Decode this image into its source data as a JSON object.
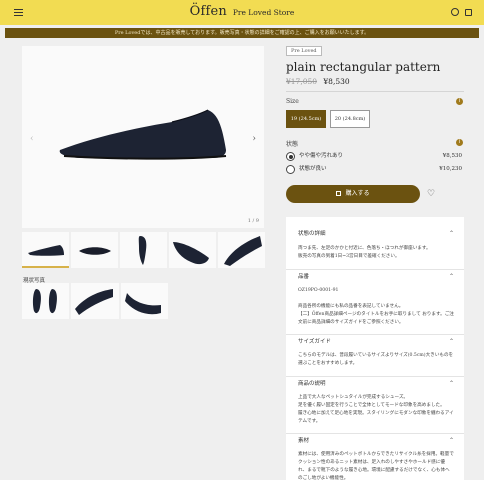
{
  "header": {
    "logo": "Öffen",
    "store_name": "Pre Loved Store"
  },
  "notice": "Pre Lovedでは、中古品を販売しております。販売写真・状態の詳細をご確認の上、ご購入をお願いいたします。",
  "gallery": {
    "counter": "1 / 9",
    "actual_title": "現状写真"
  },
  "product": {
    "badge": "Pre Loved",
    "title": "plain rectangular pattern",
    "original_price": "¥17,050",
    "price": "¥8,530"
  },
  "size": {
    "label": "Size",
    "options": [
      "19 (24.5cm)",
      "20 (24.8cm)"
    ],
    "selected_index": 0
  },
  "condition": {
    "label": "状態",
    "options": [
      {
        "name": "やや傷や汚れあり",
        "price": "¥8,530",
        "selected": true
      },
      {
        "name": "状態が良い",
        "price": "¥10,230",
        "selected": false
      }
    ]
  },
  "buy_button": "購入する",
  "accordion": [
    {
      "title": "状態の詳細",
      "body": "両つま先、左足のかかと付近に、色落ち・ほつれが御座います。\n販売の写真の到着1日~3営日目で差確ください。"
    },
    {
      "title": "品番",
      "body": "OZ19PO-0001-91\n\n商品各所の機能にも私の品番を表記していません。\n【二】Öffen商品詳細ページのタイトルをお手に取りまして おります。ご注文前に商品詳細のサイズガイドをご参照ください。"
    },
    {
      "title": "サイズガイド",
      "body": "こちらのモデルは、普段履いているサイズよりサイズ(0.5cm)大きいものを選ぶことをおすすめします。"
    },
    {
      "title": "商品の説明",
      "body": "上品で大人なペットシュタイルが完成するシューズ。\n足を優く履い固定を行うことで全体としてモードな印象を高めました。\n履き心地に加えて足心地を実現。スタイリングにモダンな印象を纏わるアイテムです。"
    },
    {
      "title": "素材",
      "body": "素材には、使用済みのペットボトルからできたリサイクル糸を採用。軽量でクッション性のあるニット素材は、足入れのしやすさやホールド感に優れ、まるで靴下のような履き心地。環境に配慮するだけでなく、心も体へのごし地がよい機能性。"
    }
  ]
}
